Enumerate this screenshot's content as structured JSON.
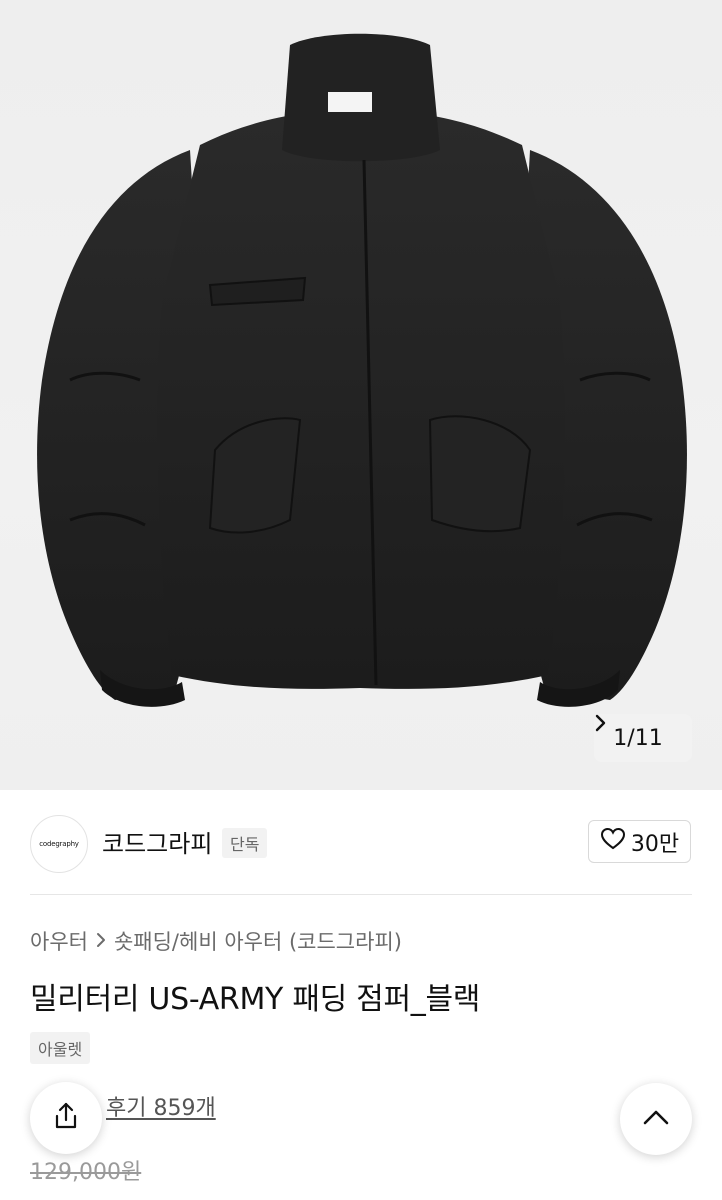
{
  "gallery": {
    "current": "1",
    "separator": "/",
    "total": "11",
    "image_icon": "black-padded-jacket-photo",
    "next_icon": "chevron-right-icon"
  },
  "brand": {
    "logo_text": "codegraphy",
    "name": "코드그라피",
    "exclusive_tag": "단독",
    "like_icon": "heart-icon",
    "like_count": "30만"
  },
  "breadcrumb": {
    "category": "아우터",
    "separator_icon": "chevron-right-icon",
    "subcategory": "숏패딩/헤비 아우터 (코드그라피)"
  },
  "product": {
    "title": "밀리터리 US-ARMY 패딩 점퍼_블랙",
    "tag": "아울렛",
    "review_label": "후기 859개",
    "original_price": "129,000원"
  },
  "fabs": {
    "share_icon": "share-icon",
    "scroll_top_icon": "chevron-up-icon"
  }
}
